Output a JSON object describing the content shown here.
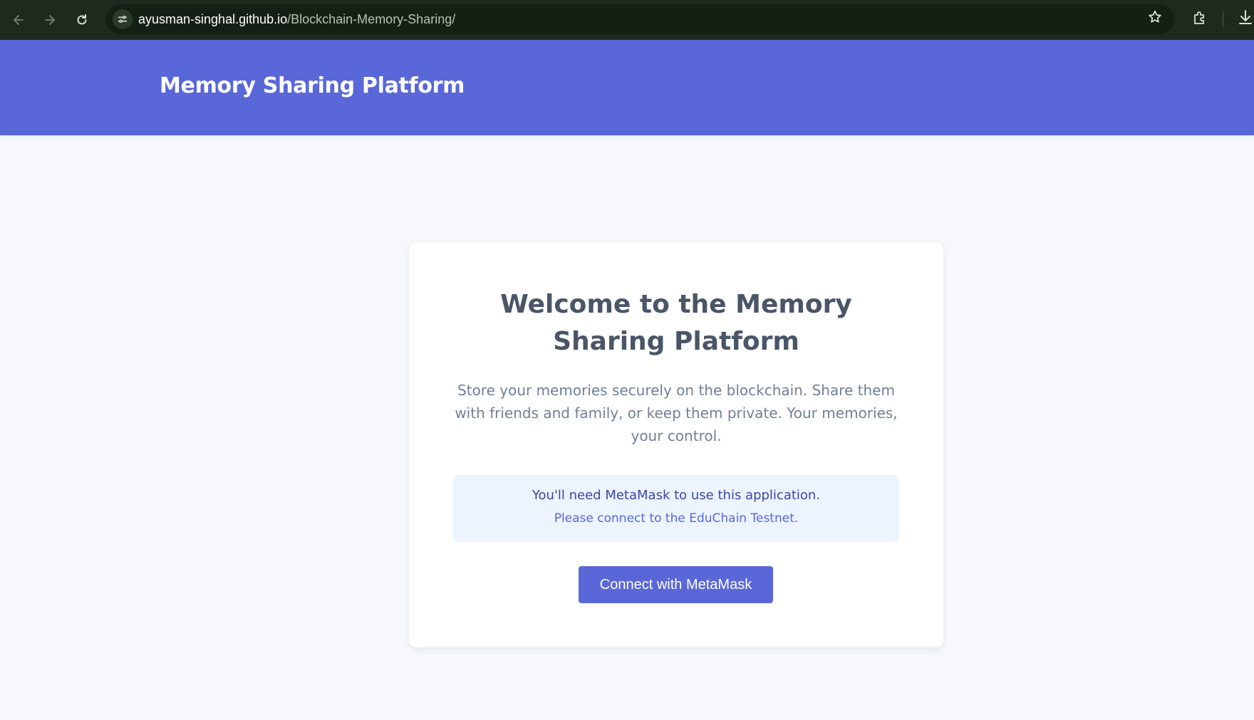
{
  "browser": {
    "url_host": "ayusman-singhal.github.io",
    "url_path": "/Blockchain-Memory-Sharing/",
    "icons": [
      "back-icon",
      "forward-icon",
      "reload-icon",
      "site-info-icon",
      "bookmark-star-icon",
      "extensions-icon",
      "download-icon"
    ]
  },
  "header": {
    "title": "Memory Sharing Platform",
    "background_color": "#5a67d8"
  },
  "welcome": {
    "title": "Welcome to the Memory Sharing Platform",
    "description": "Store your memories securely on the blockchain. Share them with friends and family, or keep them private. Your memories, your control."
  },
  "notice": {
    "main": "You'll need MetaMask to use this application.",
    "sub": "Please connect to the EduChain Testnet."
  },
  "actions": {
    "connect_label": "Connect with MetaMask"
  },
  "colors": {
    "accent": "#5a67d8",
    "page_background": "#f6f8fb",
    "notice_background": "#ebf4ff"
  }
}
